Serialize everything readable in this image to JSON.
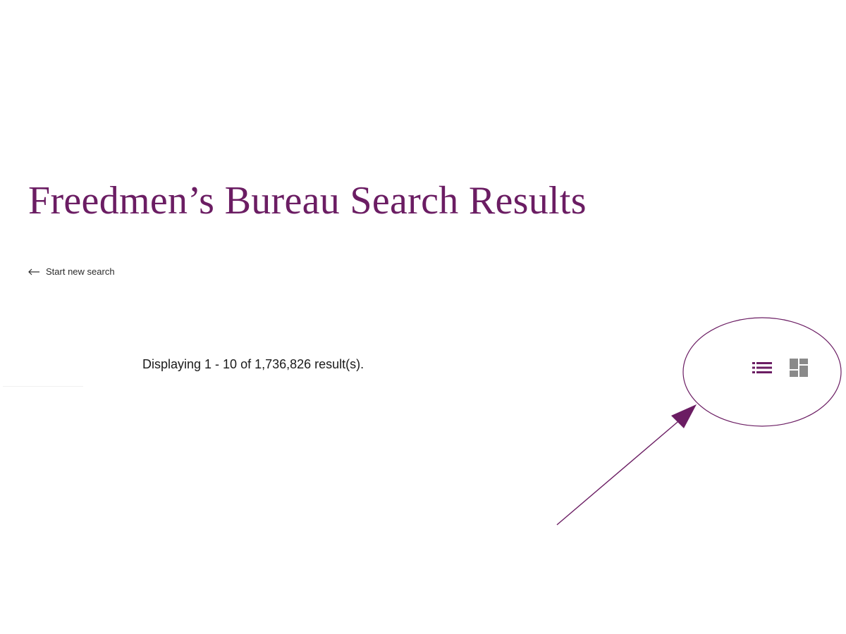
{
  "page": {
    "title": "Freedmen’s Bureau Search Results"
  },
  "nav": {
    "back_label": "Start new search",
    "back_icon": "arrow-left-icon"
  },
  "results": {
    "summary": "Displaying 1 - 10 of 1,736,826 result(s)."
  },
  "view_toggle": {
    "list_icon": "list-view-icon",
    "grid_icon": "grid-view-icon",
    "active": "list"
  },
  "annotation": {
    "shape": "ellipse-with-arrow",
    "target": "view_toggle"
  },
  "colors": {
    "brand": "#6b1d63",
    "text": "#1a1a1a",
    "icon_inactive": "#8a8a8a"
  }
}
